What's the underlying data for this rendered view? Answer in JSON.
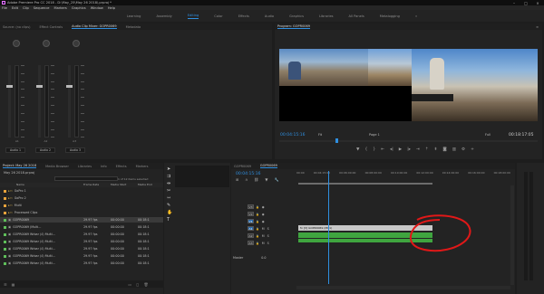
{
  "window": {
    "title": "Adobe Premiere Pro CC 2018 - D:\\May_25\\May 26 2018\\.prproj *",
    "controls": [
      "–",
      "□",
      "×"
    ]
  },
  "menu": [
    "File",
    "Edit",
    "Clip",
    "Sequence",
    "Markers",
    "Graphics",
    "Window",
    "Help"
  ],
  "workspaces": {
    "items": [
      "Learning",
      "Assembly",
      "Editing",
      "Color",
      "Effects",
      "Audio",
      "Graphics",
      "Libraries",
      "All Panels",
      "Metalogging"
    ],
    "active_index": 2,
    "more": "»"
  },
  "left_panel": {
    "tabs": [
      "Source: (no clips)",
      "Effect Controls",
      "Audio Clip Mixer: GOPR0069",
      "Metadata"
    ],
    "active_tab": 2,
    "channels": [
      "Audio 1",
      "Audio 2",
      "Audio 3"
    ],
    "channel_tags": [
      "A1",
      "A2",
      "A3"
    ],
    "scale": [
      "dB",
      "-6",
      "-12",
      "-18",
      "-24",
      "-30",
      "-36",
      "-42",
      "-48",
      "-54"
    ]
  },
  "program_monitor": {
    "tab": "Program: GOPR0069",
    "menu_icon": "≡",
    "timecode_current": "00:04:15:16",
    "fit": "Fit",
    "page": "Page 1",
    "full": "Full",
    "timecode_duration": "00:18:17:05",
    "transport_icons": [
      "marker-icon",
      "in-point-icon",
      "out-point-icon",
      "go-to-in-icon",
      "step-back-icon",
      "play-icon",
      "step-forward-icon",
      "go-to-out-icon",
      "lift-icon",
      "extract-icon",
      "export-frame-icon",
      "comparison-icon",
      "settings-icon",
      "add-icon"
    ]
  },
  "project_panel": {
    "tabs": [
      "Project: May 26 2018",
      "Media Browser",
      "Libraries",
      "Info",
      "Effects",
      "Markers"
    ],
    "active_tab": 0,
    "project_file": "May 26 2018.prproj",
    "items_selected": "1 of 12 items selected",
    "columns": [
      "Name",
      "Frame Rate",
      "Media Start",
      "Media End"
    ],
    "rows": [
      {
        "name": "GoPro 1",
        "fps": "",
        "start": "",
        "end": "",
        "color": "#e8a33b",
        "kind": "bin"
      },
      {
        "name": "GoPro 2",
        "fps": "",
        "start": "",
        "end": "",
        "color": "#e8a33b",
        "kind": "bin"
      },
      {
        "name": "Multi",
        "fps": "",
        "start": "",
        "end": "",
        "color": "#e8a33b",
        "kind": "bin"
      },
      {
        "name": "Processed Clips",
        "fps": "",
        "start": "",
        "end": "",
        "color": "#e8a33b",
        "kind": "bin"
      },
      {
        "name": "GOPR0069",
        "fps": "29.97 fps",
        "start": "00:00:00",
        "end": "00:18:1",
        "color": "#5fbf5a",
        "kind": "clip"
      },
      {
        "name": "GOPR0069 (Multi...",
        "fps": "29.97 fps",
        "start": "00:00:00",
        "end": "00:18:1",
        "color": "#5fbf5a",
        "kind": "clip"
      },
      {
        "name": "GOPR0069 Wrbar (4) Multi...",
        "fps": "29.97 fps",
        "start": "00:00:00",
        "end": "00:18:1",
        "color": "#5fbf5a",
        "kind": "clip"
      },
      {
        "name": "GOPR0069 Wrbar (4) Multi...",
        "fps": "29.97 fps",
        "start": "00:00:00",
        "end": "00:18:1",
        "color": "#5fbf5a",
        "kind": "clip"
      },
      {
        "name": "GOPR0069 Wrbar (4) Multi...",
        "fps": "29.97 fps",
        "start": "00:00:00",
        "end": "00:18:1",
        "color": "#5fbf5a",
        "kind": "clip"
      },
      {
        "name": "GOPR0069 Wrbar (4) Multi...",
        "fps": "29.97 fps",
        "start": "00:00:00",
        "end": "00:18:1",
        "color": "#5fbf5a",
        "kind": "clip"
      },
      {
        "name": "GOPR0069 Wrbar (4) Multi...",
        "fps": "29.97 fps",
        "start": "00:00:00",
        "end": "00:18:1",
        "color": "#5fbf5a",
        "kind": "clip"
      }
    ]
  },
  "timeline": {
    "tabs": [
      "GOPR0069",
      "GOPR0069"
    ],
    "active_tab": 1,
    "timecode": "00:04:15:16",
    "ruler": [
      "00:00",
      "00:04:15:00",
      "00:06:00:00",
      "00:08:00:00",
      "00:10:00:00",
      "00:12:00:00",
      "00:14:00:00",
      "00:16:00:00",
      "00:18:00:00"
    ],
    "tracks": [
      {
        "tag": "V3",
        "on": false
      },
      {
        "tag": "V2",
        "on": false
      },
      {
        "tag": "V1",
        "on": true
      },
      {
        "tag": "A1",
        "on": true
      },
      {
        "tag": "A2",
        "on": false
      },
      {
        "tag": "A3",
        "on": false
      }
    ],
    "master": "Master",
    "master_value": "0.0",
    "clip_label": "[V] GOPR0069 (MC1)",
    "clip_fx": "fx"
  },
  "colors": {
    "accent": "#2f8fe0",
    "clip_video": "#c8c8c8",
    "clip_audio": "#3fa53f",
    "annotation": "#e01818"
  }
}
